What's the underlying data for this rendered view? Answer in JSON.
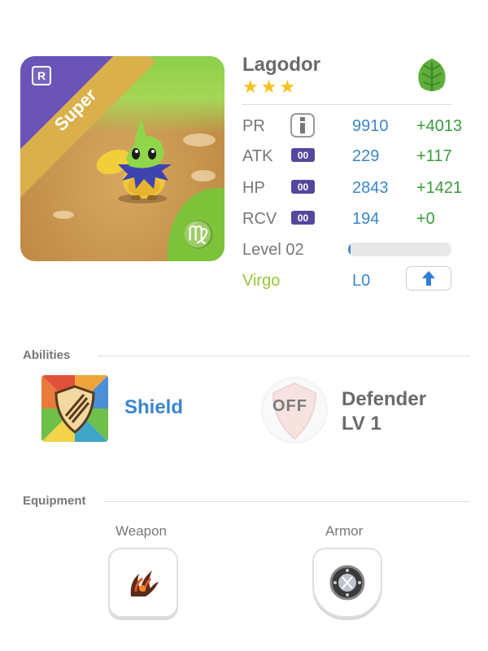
{
  "monster": {
    "name": "Lagodor",
    "stars": 3,
    "rarity_badge": "R",
    "rarity_label": "Super",
    "element": "leaf-icon",
    "zodiac_symbol": "♍",
    "colors": {
      "rarity_purple": "#6a54b8",
      "banner_gold": "#d9b04a",
      "stat_blue": "#3b86c8",
      "bonus_green": "#3a9a3a",
      "zodiac_green": "#9ac43a",
      "tag_purple": "#53489e"
    }
  },
  "stats": [
    {
      "label": "PR",
      "tag": "",
      "value": "9910",
      "bonus": "+4013"
    },
    {
      "label": "ATK",
      "tag": "00",
      "value": "229",
      "bonus": "+117"
    },
    {
      "label": "HP",
      "tag": "00",
      "value": "2843",
      "bonus": "+1421"
    },
    {
      "label": "RCV",
      "tag": "00",
      "value": "194",
      "bonus": "+0"
    }
  ],
  "level": {
    "label": "Level 02",
    "progress": 0.02
  },
  "zodiac": {
    "label": "Virgo",
    "level": "L0"
  },
  "abilities": {
    "section_title": "Abilities",
    "active": {
      "name": "Shield"
    },
    "leader": {
      "status": "OFF",
      "name_line1": "Defender",
      "name_line2": "LV 1"
    }
  },
  "equipment": {
    "section_title": "Equipment",
    "weapon_label": "Weapon",
    "armor_label": "Armor"
  }
}
